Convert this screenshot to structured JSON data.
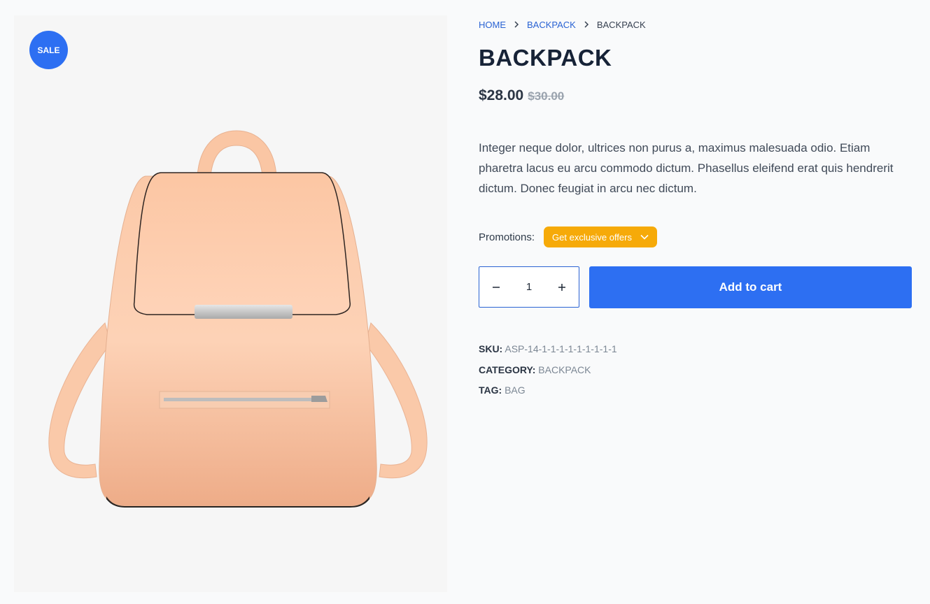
{
  "gallery": {
    "sale_badge": "SALE"
  },
  "breadcrumb": {
    "items": [
      "HOME",
      "BACKPACK"
    ],
    "current": "BACKPACK"
  },
  "product": {
    "title": "BACKPACK",
    "price": "$28.00",
    "old_price": "$30.00",
    "description": "Integer neque dolor, ultrices non purus a, maximus malesuada odio. Etiam pharetra lacus eu arcu commodo dictum. Phasellus eleifend erat quis hendrerit dictum. Donec feugiat in arcu nec dictum."
  },
  "promotions": {
    "label": "Promotions:",
    "button": "Get exclusive offers"
  },
  "quantity": {
    "value": "1"
  },
  "cart": {
    "add_label": "Add to cart"
  },
  "meta": {
    "sku_label": "SKU:",
    "sku": "ASP-14-1-1-1-1-1-1-1-1-1",
    "category_label": "CATEGORY:",
    "category": "BACKPACK",
    "tag_label": "TAG:",
    "tag": "BAG"
  },
  "colors": {
    "accent": "#2d6ff2",
    "promo": "#f6aa09",
    "backpack": "#fdd3b7"
  },
  "icons": {
    "breadcrumb_separator": "chevron-right-icon",
    "promo": "chevron-down-icon",
    "qty_minus": "minus-icon",
    "qty_plus": "plus-icon"
  }
}
